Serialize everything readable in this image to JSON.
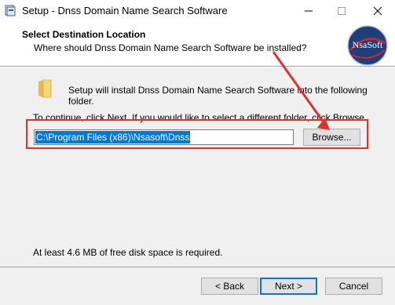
{
  "window": {
    "title": "Setup - Dnss Domain Name Search Software",
    "min_icon": "minimize-icon",
    "max_icon": "maximize-icon",
    "close_icon": "close-icon"
  },
  "header": {
    "title": "Select Destination Location",
    "subtitle": "Where should Dnss Domain Name Search Software be installed?",
    "logo_text": "NsaSoft"
  },
  "main": {
    "setup_text": "Setup will install Dnss Domain Name Search Software into the following folder.",
    "continue_text": "To continue, click Next. If you would like to select a different folder, click Browse.",
    "path_value": "C:\\Program Files (x86)\\Nsasoft\\Dnss",
    "browse_label": "Browse...",
    "disk_space_text": "At least 4.6 MB of free disk space is required."
  },
  "footer": {
    "back_label": "< Back",
    "next_label": "Next >",
    "cancel_label": "Cancel"
  },
  "colors": {
    "annotation_red": "#e03030",
    "selection_blue": "#0078d7"
  }
}
